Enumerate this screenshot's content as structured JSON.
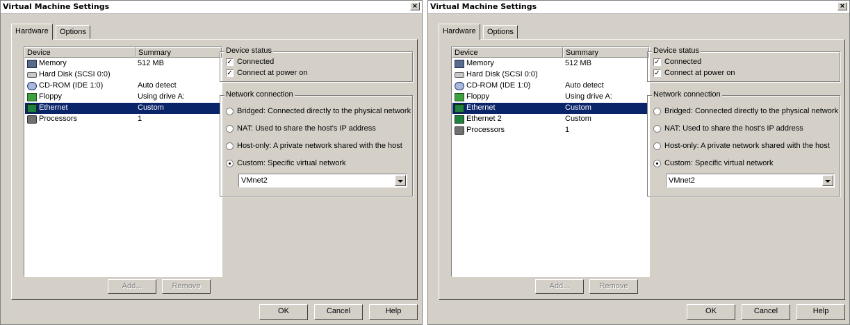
{
  "dialogs": [
    {
      "title": "Virtual Machine Settings",
      "close_glyph": "×",
      "tabs": [
        "Hardware",
        "Options"
      ],
      "columns": [
        "Device",
        "Summary"
      ],
      "devices": [
        {
          "name": "Memory",
          "summary": "512 MB",
          "icon": "memory-icon",
          "selected": false
        },
        {
          "name": "Hard Disk (SCSI 0:0)",
          "summary": "",
          "icon": "hard-disk-icon",
          "selected": false
        },
        {
          "name": "CD-ROM (IDE 1:0)",
          "summary": "Auto detect",
          "icon": "cdrom-icon",
          "selected": false
        },
        {
          "name": "Floppy",
          "summary": "Using drive A:",
          "icon": "floppy-icon",
          "selected": false
        },
        {
          "name": "Ethernet",
          "summary": "Custom",
          "icon": "ethernet-icon",
          "selected": true
        },
        {
          "name": "Processors",
          "summary": "1",
          "icon": "processor-icon",
          "selected": false
        }
      ],
      "add_label": "Add...",
      "remove_label": "Remove",
      "device_status": {
        "title": "Device status",
        "connected": "Connected",
        "connect_at_power_on": "Connect at power on"
      },
      "network": {
        "title": "Network connection",
        "options": [
          "Bridged: Connected directly to the physical network",
          "NAT: Used to share the host's IP address",
          "Host-only: A private network shared with the host",
          "Custom: Specific virtual network"
        ],
        "selected_index": 3,
        "vmnet_value": "VMnet2"
      },
      "ok_label": "OK",
      "cancel_label": "Cancel",
      "help_label": "Help"
    },
    {
      "title": "Virtual Machine Settings",
      "close_glyph": "×",
      "tabs": [
        "Hardware",
        "Options"
      ],
      "columns": [
        "Device",
        "Summary"
      ],
      "devices": [
        {
          "name": "Memory",
          "summary": "512 MB",
          "icon": "memory-icon",
          "selected": false
        },
        {
          "name": "Hard Disk (SCSI 0:0)",
          "summary": "",
          "icon": "hard-disk-icon",
          "selected": false
        },
        {
          "name": "CD-ROM (IDE 1:0)",
          "summary": "Auto detect",
          "icon": "cdrom-icon",
          "selected": false
        },
        {
          "name": "Floppy",
          "summary": "Using drive A:",
          "icon": "floppy-icon",
          "selected": false
        },
        {
          "name": "Ethernet",
          "summary": "Custom",
          "icon": "ethernet-icon",
          "selected": true
        },
        {
          "name": "Ethernet 2",
          "summary": "Custom",
          "icon": "ethernet-icon",
          "selected": false
        },
        {
          "name": "Processors",
          "summary": "1",
          "icon": "processor-icon",
          "selected": false
        }
      ],
      "add_label": "Add...",
      "remove_label": "Remove",
      "device_status": {
        "title": "Device status",
        "connected": "Connected",
        "connect_at_power_on": "Connect at power on"
      },
      "network": {
        "title": "Network connection",
        "options": [
          "Bridged: Connected directly to the physical network",
          "NAT: Used to share the host's IP address",
          "Host-only: A private network shared with the host",
          "Custom: Specific virtual network"
        ],
        "selected_index": 3,
        "vmnet_value": "VMnet2"
      },
      "ok_label": "OK",
      "cancel_label": "Cancel",
      "help_label": "Help"
    }
  ],
  "colors": {
    "dialog_face": "#d4d0c8",
    "selection": "#0a246a"
  }
}
